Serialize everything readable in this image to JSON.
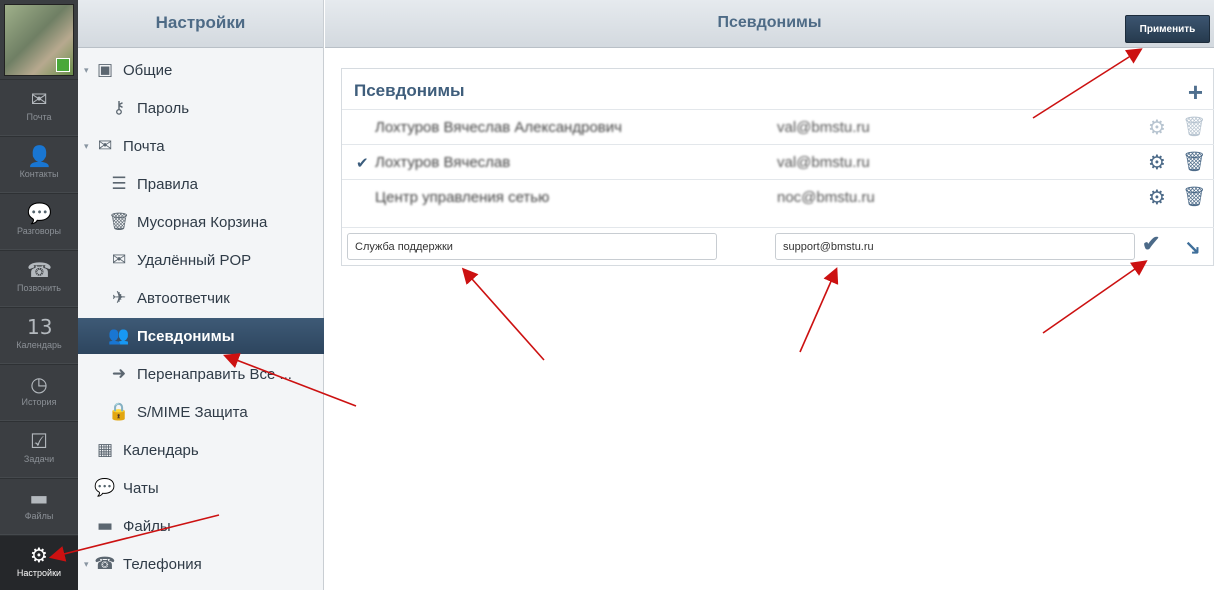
{
  "rail": {
    "items": [
      {
        "label": "Почта",
        "icon": "mail-icon",
        "glyph": "✉"
      },
      {
        "label": "Контакты",
        "icon": "contacts-icon",
        "glyph": "👤"
      },
      {
        "label": "Разговоры",
        "icon": "chat-icon",
        "glyph": "💬"
      },
      {
        "label": "Позвонить",
        "icon": "phone-icon",
        "glyph": "☎"
      },
      {
        "label": "Календарь",
        "icon": "calendar-icon",
        "glyph": "13"
      },
      {
        "label": "История",
        "icon": "history-icon",
        "glyph": "◷"
      },
      {
        "label": "Задачи",
        "icon": "tasks-icon",
        "glyph": "☑"
      },
      {
        "label": "Файлы",
        "icon": "folder-icon",
        "glyph": "▬"
      },
      {
        "label": "Настройки",
        "icon": "gear-icon",
        "glyph": "⚙"
      }
    ]
  },
  "settings": {
    "title": "Настройки",
    "items": [
      {
        "label": "Общие",
        "icon": "general-icon",
        "glyph": "▣"
      },
      {
        "label": "Пароль",
        "icon": "key-icon",
        "glyph": "⚷"
      },
      {
        "label": "Почта",
        "icon": "mail-icon",
        "glyph": "✉"
      },
      {
        "label": "Правила",
        "icon": "filters-icon",
        "glyph": "☰"
      },
      {
        "label": "Мусорная Корзина",
        "icon": "trash-icon",
        "glyph": "🗑"
      },
      {
        "label": "Удалённый POP",
        "icon": "mail-icon",
        "glyph": "✉"
      },
      {
        "label": "Автоответчик",
        "icon": "airplane-icon",
        "glyph": "✈"
      },
      {
        "label": "Псевдонимы",
        "icon": "aliases-icon",
        "glyph": "👥"
      },
      {
        "label": "Перенаправить Все ...",
        "icon": "arrow-right-icon",
        "glyph": "➜"
      },
      {
        "label": "S/MIME Защита",
        "icon": "lock-icon",
        "glyph": "🔒"
      },
      {
        "label": "Календарь",
        "icon": "calendar-icon",
        "glyph": "▦"
      },
      {
        "label": "Чаты",
        "icon": "chat-icon",
        "glyph": "💬"
      },
      {
        "label": "Файлы",
        "icon": "folder-icon",
        "glyph": "▬"
      },
      {
        "label": "Телефония",
        "icon": "phone-icon",
        "glyph": "☎"
      }
    ]
  },
  "main": {
    "title": "Псевдонимы",
    "apply_label": "Применить",
    "panel_title": "Псевдонимы",
    "rows": [
      {
        "name": "Лохтуров Вячеслав Александрович",
        "email": "val@bmstu.ru",
        "default": false
      },
      {
        "name": "Лохтуров Вячеслав",
        "email": "val@bmstu.ru",
        "default": true
      },
      {
        "name": "Центр управления сетью",
        "email": "noc@bmstu.ru",
        "default": false
      }
    ],
    "edit": {
      "name_value": "Служба поддержки",
      "email_value": "support@bmstu.ru"
    }
  },
  "colors": {
    "accent": "#2d455e",
    "annotation": "#cc1111"
  }
}
